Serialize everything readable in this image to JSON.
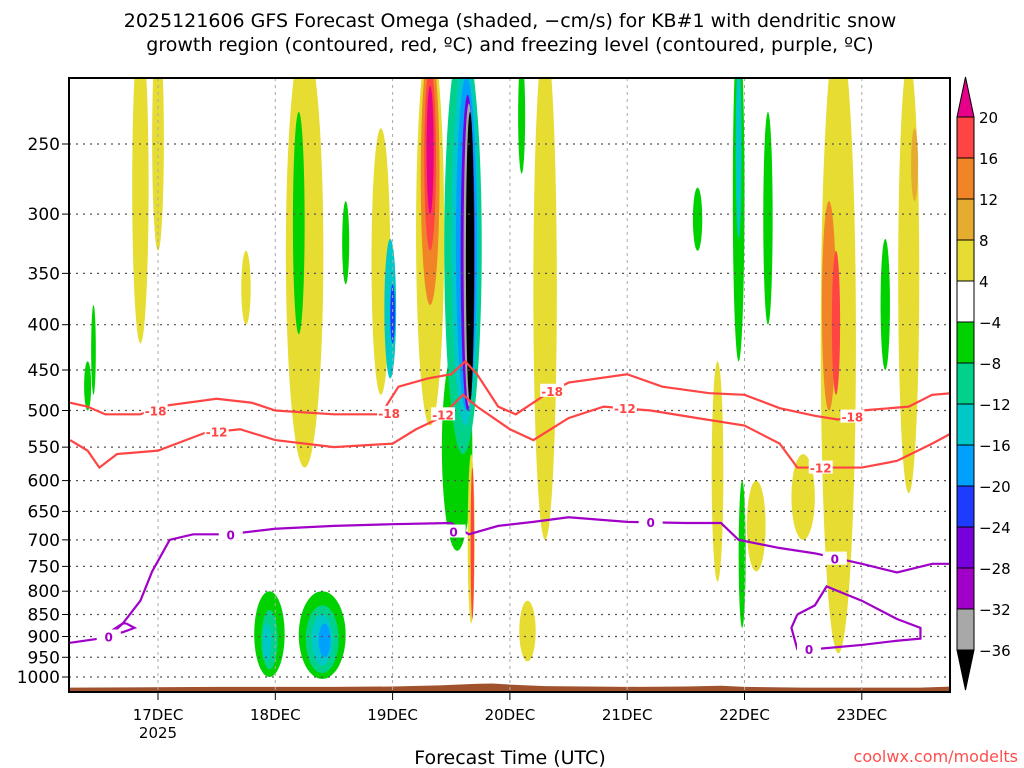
{
  "chart_data": {
    "type": "heatmap",
    "title_lines": [
      "2025121606 GFS Forecast Omega (shaded, −cm/s) for KB#1 with dendritic snow",
      "growth region (contoured, red, ºC) and freezing level (contoured, purple, ºC)"
    ],
    "xlabel": "Forecast Time (UTC)",
    "ylabel": "",
    "credit": "coolwx.com/modelts",
    "xlim_days_dec": [
      16.25,
      23.77
    ],
    "ylim_hpa": [
      181,
      1040
    ],
    "y_scale": "log",
    "y_ticks": [
      250,
      300,
      350,
      400,
      450,
      500,
      550,
      600,
      650,
      700,
      750,
      800,
      850,
      900,
      950,
      1000
    ],
    "x_ticks": [
      {
        "day": 17,
        "label": "17DEC",
        "sub": "2025"
      },
      {
        "day": 18,
        "label": "18DEC",
        "sub": ""
      },
      {
        "day": 19,
        "label": "19DEC",
        "sub": ""
      },
      {
        "day": 20,
        "label": "20DEC",
        "sub": ""
      },
      {
        "day": 21,
        "label": "21DEC",
        "sub": ""
      },
      {
        "day": 22,
        "label": "22DEC",
        "sub": ""
      },
      {
        "day": 23,
        "label": "23DEC",
        "sub": ""
      }
    ],
    "grid": true,
    "colorbar": {
      "labels": [
        "20",
        "16",
        "12",
        "8",
        "4",
        "−4",
        "−8",
        "−12",
        "−16",
        "−20",
        "−24",
        "−28",
        "−32",
        "−36"
      ],
      "colors": [
        "#ff4444",
        "#f08426",
        "#e6ac30",
        "#e6dc32",
        "#ffffff",
        "#00d200",
        "#00d28c",
        "#00c8c8",
        "#00a0ff",
        "#1e3cff",
        "#7800dc",
        "#a000c8",
        "#a8a8a8"
      ],
      "over_color": "#e6008a",
      "under_color": "#000000"
    },
    "shaded_regions": [
      {
        "t": 16.85,
        "p_top": 185,
        "p_bot": 420,
        "dt": 0.07,
        "level": 4
      },
      {
        "t": 17.0,
        "p_top": 185,
        "p_bot": 330,
        "dt": 0.05,
        "level": 4
      },
      {
        "t": 16.4,
        "p_top": 440,
        "p_bot": 500,
        "dt": 0.03,
        "level": -4
      },
      {
        "t": 17.75,
        "p_top": 330,
        "p_bot": 400,
        "dt": 0.04,
        "level": 4
      },
      {
        "t": 18.25,
        "p_top": 190,
        "p_bot": 580,
        "dt": 0.16,
        "level": 4
      },
      {
        "t": 18.2,
        "p_top": 230,
        "p_bot": 410,
        "dt": 0.05,
        "level": -4
      },
      {
        "t": 18.6,
        "p_top": 290,
        "p_bot": 360,
        "dt": 0.03,
        "level": -4
      },
      {
        "t": 18.9,
        "p_top": 240,
        "p_bot": 480,
        "dt": 0.08,
        "level": 4
      },
      {
        "t": 18.98,
        "p_top": 320,
        "p_bot": 460,
        "dt": 0.05,
        "level": -12
      },
      {
        "t": 19.0,
        "p_top": 360,
        "p_bot": 420,
        "dt": 0.02,
        "level": -20
      },
      {
        "t": 19.32,
        "p_top": 190,
        "p_bot": 520,
        "dt": 0.12,
        "level": 4
      },
      {
        "t": 19.32,
        "p_top": 195,
        "p_bot": 380,
        "dt": 0.08,
        "level": 12
      },
      {
        "t": 19.32,
        "p_top": 205,
        "p_bot": 330,
        "dt": 0.05,
        "level": 16
      },
      {
        "t": 19.32,
        "p_top": 215,
        "p_bot": 300,
        "dt": 0.03,
        "level": 20
      },
      {
        "t": 19.55,
        "p_top": 420,
        "p_bot": 720,
        "dt": 0.13,
        "level": -4
      },
      {
        "t": 19.6,
        "p_top": 190,
        "p_bot": 560,
        "dt": 0.16,
        "level": -8
      },
      {
        "t": 19.62,
        "p_top": 200,
        "p_bot": 520,
        "dt": 0.12,
        "level": -12
      },
      {
        "t": 19.63,
        "p_top": 210,
        "p_bot": 500,
        "dt": 0.09,
        "level": -16
      },
      {
        "t": 19.64,
        "p_top": 220,
        "p_bot": 500,
        "dt": 0.06,
        "level": -24
      },
      {
        "t": 19.65,
        "p_top": 225,
        "p_bot": 495,
        "dt": 0.045,
        "level": -32
      },
      {
        "t": 19.66,
        "p_top": 230,
        "p_bot": 490,
        "dt": 0.035,
        "level": -36
      },
      {
        "t": 19.67,
        "p_top": 560,
        "p_bot": 870,
        "dt": 0.03,
        "level": 4
      },
      {
        "t": 19.68,
        "p_top": 580,
        "p_bot": 860,
        "dt": 0.015,
        "level": 16
      },
      {
        "t": 20.3,
        "p_top": 190,
        "p_bot": 700,
        "dt": 0.1,
        "level": 4
      },
      {
        "t": 20.1,
        "p_top": 200,
        "p_bot": 270,
        "dt": 0.03,
        "level": -4
      },
      {
        "t": 20.15,
        "p_top": 820,
        "p_bot": 960,
        "dt": 0.07,
        "level": 4
      },
      {
        "t": 21.6,
        "p_top": 280,
        "p_bot": 330,
        "dt": 0.04,
        "level": -4
      },
      {
        "t": 21.95,
        "p_top": 185,
        "p_bot": 440,
        "dt": 0.05,
        "level": -4
      },
      {
        "t": 21.95,
        "p_top": 200,
        "p_bot": 320,
        "dt": 0.025,
        "level": -12
      },
      {
        "t": 21.77,
        "p_top": 440,
        "p_bot": 780,
        "dt": 0.05,
        "level": 4
      },
      {
        "t": 21.98,
        "p_top": 600,
        "p_bot": 880,
        "dt": 0.03,
        "level": -4
      },
      {
        "t": 22.2,
        "p_top": 230,
        "p_bot": 400,
        "dt": 0.04,
        "level": -4
      },
      {
        "t": 22.1,
        "p_top": 600,
        "p_bot": 760,
        "dt": 0.08,
        "level": 4
      },
      {
        "t": 22.5,
        "p_top": 560,
        "p_bot": 700,
        "dt": 0.1,
        "level": 4
      },
      {
        "t": 22.8,
        "p_top": 185,
        "p_bot": 940,
        "dt": 0.15,
        "level": 4
      },
      {
        "t": 22.72,
        "p_top": 290,
        "p_bot": 500,
        "dt": 0.06,
        "level": 12
      },
      {
        "t": 22.78,
        "p_top": 330,
        "p_bot": 480,
        "dt": 0.035,
        "level": 16
      },
      {
        "t": 23.2,
        "p_top": 320,
        "p_bot": 450,
        "dt": 0.04,
        "level": -4
      },
      {
        "t": 23.4,
        "p_top": 200,
        "p_bot": 620,
        "dt": 0.09,
        "level": 4
      },
      {
        "t": 23.45,
        "p_top": 240,
        "p_bot": 290,
        "dt": 0.03,
        "level": 8
      },
      {
        "t": 17.95,
        "p_top": 800,
        "p_bot": 1000,
        "dt": 0.13,
        "level": -4
      },
      {
        "t": 17.95,
        "p_top": 840,
        "p_bot": 980,
        "dt": 0.07,
        "level": -8
      },
      {
        "t": 17.93,
        "p_top": 870,
        "p_bot": 960,
        "dt": 0.035,
        "level": -12
      },
      {
        "t": 18.4,
        "p_top": 800,
        "p_bot": 1005,
        "dt": 0.2,
        "level": -4
      },
      {
        "t": 18.4,
        "p_top": 830,
        "p_bot": 990,
        "dt": 0.14,
        "level": -8
      },
      {
        "t": 18.4,
        "p_top": 850,
        "p_bot": 970,
        "dt": 0.09,
        "level": -12
      },
      {
        "t": 18.42,
        "p_top": 870,
        "p_bot": 950,
        "dt": 0.05,
        "level": -16
      },
      {
        "t": 16.45,
        "p_top": 380,
        "p_bot": 480,
        "dt": 0.02,
        "level": -4
      }
    ],
    "contours": [
      {
        "name": "dendritic -18C",
        "color": "#ff4444",
        "points": [
          [
            16.25,
            490
          ],
          [
            16.4,
            495
          ],
          [
            16.55,
            505
          ],
          [
            16.85,
            505
          ],
          [
            17.0,
            495
          ],
          [
            17.5,
            485
          ],
          [
            17.8,
            490
          ],
          [
            18.0,
            500
          ],
          [
            18.5,
            505
          ],
          [
            18.9,
            505
          ],
          [
            19.05,
            470
          ],
          [
            19.3,
            460
          ],
          [
            19.5,
            455
          ],
          [
            19.62,
            440
          ],
          [
            19.72,
            455
          ],
          [
            19.9,
            495
          ],
          [
            20.05,
            505
          ],
          [
            20.3,
            480
          ],
          [
            20.5,
            465
          ],
          [
            21.0,
            455
          ],
          [
            21.3,
            470
          ],
          [
            21.7,
            478
          ],
          [
            22.0,
            480
          ],
          [
            22.3,
            497
          ],
          [
            22.6,
            507
          ],
          [
            22.8,
            512
          ],
          [
            23.0,
            500
          ],
          [
            23.4,
            495
          ],
          [
            23.6,
            480
          ],
          [
            23.77,
            478
          ]
        ]
      },
      {
        "name": "dendritic -12C",
        "color": "#ff4444",
        "points": [
          [
            16.25,
            540
          ],
          [
            16.4,
            555
          ],
          [
            16.5,
            580
          ],
          [
            16.65,
            560
          ],
          [
            17.0,
            555
          ],
          [
            17.4,
            530
          ],
          [
            17.7,
            525
          ],
          [
            18.0,
            540
          ],
          [
            18.5,
            550
          ],
          [
            19.0,
            545
          ],
          [
            19.2,
            525
          ],
          [
            19.4,
            510
          ],
          [
            19.6,
            480
          ],
          [
            19.72,
            495
          ],
          [
            20.0,
            525
          ],
          [
            20.2,
            540
          ],
          [
            20.5,
            510
          ],
          [
            20.8,
            495
          ],
          [
            21.2,
            500
          ],
          [
            21.6,
            510
          ],
          [
            22.0,
            520
          ],
          [
            22.3,
            545
          ],
          [
            22.45,
            580
          ],
          [
            23.0,
            580
          ],
          [
            23.3,
            570
          ],
          [
            23.6,
            545
          ],
          [
            23.77,
            530
          ]
        ]
      },
      {
        "name": "freezing 0C",
        "color": "#a000c8",
        "points": [
          [
            16.25,
            915
          ],
          [
            16.5,
            905
          ],
          [
            16.7,
            870
          ],
          [
            16.85,
            820
          ],
          [
            16.95,
            760
          ],
          [
            17.1,
            700
          ],
          [
            17.3,
            690
          ],
          [
            17.6,
            690
          ],
          [
            18.0,
            680
          ],
          [
            18.5,
            675
          ],
          [
            19.0,
            672
          ],
          [
            19.5,
            670
          ],
          [
            19.65,
            690
          ],
          [
            19.9,
            675
          ],
          [
            20.2,
            668
          ],
          [
            20.5,
            660
          ],
          [
            21.0,
            668
          ],
          [
            21.5,
            670
          ],
          [
            21.8,
            670
          ],
          [
            21.95,
            700
          ],
          [
            22.3,
            715
          ],
          [
            22.6,
            725
          ],
          [
            23.0,
            745
          ],
          [
            23.3,
            762
          ],
          [
            23.6,
            745
          ],
          [
            23.77,
            745
          ]
        ]
      },
      {
        "name": "freezing 0C loop",
        "color": "#a000c8",
        "points": [
          [
            22.45,
            850
          ],
          [
            22.6,
            830
          ],
          [
            22.7,
            790
          ],
          [
            22.8,
            800
          ],
          [
            23.0,
            820
          ],
          [
            23.3,
            860
          ],
          [
            23.5,
            880
          ],
          [
            23.5,
            905
          ],
          [
            23.3,
            910
          ],
          [
            23.0,
            920
          ],
          [
            22.6,
            930
          ],
          [
            22.45,
            930
          ],
          [
            22.4,
            880
          ],
          [
            22.45,
            850
          ]
        ]
      },
      {
        "name": "freezing 0C small",
        "color": "#a000c8",
        "points": [
          [
            16.73,
            870
          ],
          [
            16.8,
            880
          ],
          [
            16.7,
            890
          ],
          [
            16.6,
            895
          ],
          [
            16.7,
            870
          ],
          [
            16.73,
            870
          ]
        ]
      }
    ],
    "contour_labels": [
      {
        "text": "-18",
        "t": 16.98,
        "p": 500,
        "color": "#ff4444"
      },
      {
        "text": "-12",
        "t": 17.5,
        "p": 528,
        "color": "#ff4444"
      },
      {
        "text": "-18",
        "t": 18.97,
        "p": 503,
        "color": "#ff4444"
      },
      {
        "text": "-12",
        "t": 19.43,
        "p": 505,
        "color": "#ff4444"
      },
      {
        "text": "-18",
        "t": 20.36,
        "p": 475,
        "color": "#ff4444"
      },
      {
        "text": "-12",
        "t": 20.98,
        "p": 497,
        "color": "#ff4444"
      },
      {
        "text": "-18",
        "t": 22.92,
        "p": 508,
        "color": "#ff4444"
      },
      {
        "text": "-12",
        "t": 22.65,
        "p": 580,
        "color": "#ff4444"
      },
      {
        "text": "0",
        "t": 16.58,
        "p": 900,
        "color": "#a000c8"
      },
      {
        "text": "0",
        "t": 17.62,
        "p": 690,
        "color": "#a000c8"
      },
      {
        "text": "0",
        "t": 19.52,
        "p": 685,
        "color": "#a000c8"
      },
      {
        "text": "0",
        "t": 21.2,
        "p": 668,
        "color": "#a000c8"
      },
      {
        "text": "0",
        "t": 22.77,
        "p": 735,
        "color": "#a000c8"
      },
      {
        "text": "0",
        "t": 22.55,
        "p": 930,
        "color": "#a000c8"
      }
    ],
    "terrain_color": "#a0522d",
    "terrain_hpa": [
      [
        16.25,
        1028
      ],
      [
        17.5,
        1026
      ],
      [
        18.5,
        1026
      ],
      [
        19.0,
        1025
      ],
      [
        19.4,
        1022
      ],
      [
        19.7,
        1018
      ],
      [
        19.85,
        1017
      ],
      [
        20.0,
        1020
      ],
      [
        20.3,
        1024
      ],
      [
        21.0,
        1026
      ],
      [
        21.5,
        1025
      ],
      [
        21.8,
        1023
      ],
      [
        22.0,
        1026
      ],
      [
        22.5,
        1028
      ],
      [
        23.0,
        1028
      ],
      [
        23.5,
        1028
      ],
      [
        23.77,
        1025
      ]
    ]
  }
}
